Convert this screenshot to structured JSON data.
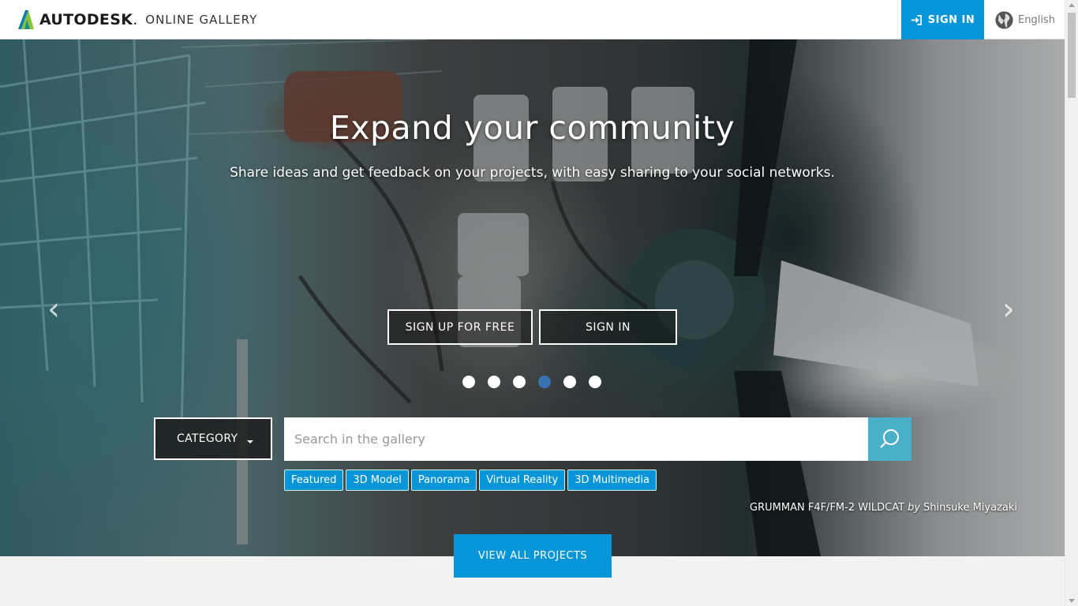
{
  "header": {
    "brand": "AUTODESK",
    "brand_dot": ".",
    "product": "ONLINE GALLERY",
    "signin_label": "SIGN IN",
    "language": "English"
  },
  "hero": {
    "title": "Expand your community",
    "subtitle": "Share ideas and get feedback on your projects, with easy sharing to your social networks.",
    "signup_label": "SIGN UP FOR FREE",
    "signin_label": "SIGN IN",
    "prev_arrow": "‹",
    "next_arrow": "›",
    "slides_count": 6,
    "active_slide": 4
  },
  "search": {
    "category_label": "CATEGORY",
    "placeholder": "Search in the gallery",
    "tags": [
      "Featured",
      "3D Model",
      "Panorama",
      "Virtual Reality",
      "3D Multimedia"
    ]
  },
  "credit": {
    "project": "GRUMMAN F4F/FM-2 WILDCAT",
    "by": "by",
    "author": "Shinsuke Miyazaki"
  },
  "view_all_label": "VIEW ALL PROJECTS",
  "colors": {
    "accent": "#0696d7",
    "search_button": "#4aafc9",
    "active_dot": "#3a72b0"
  }
}
